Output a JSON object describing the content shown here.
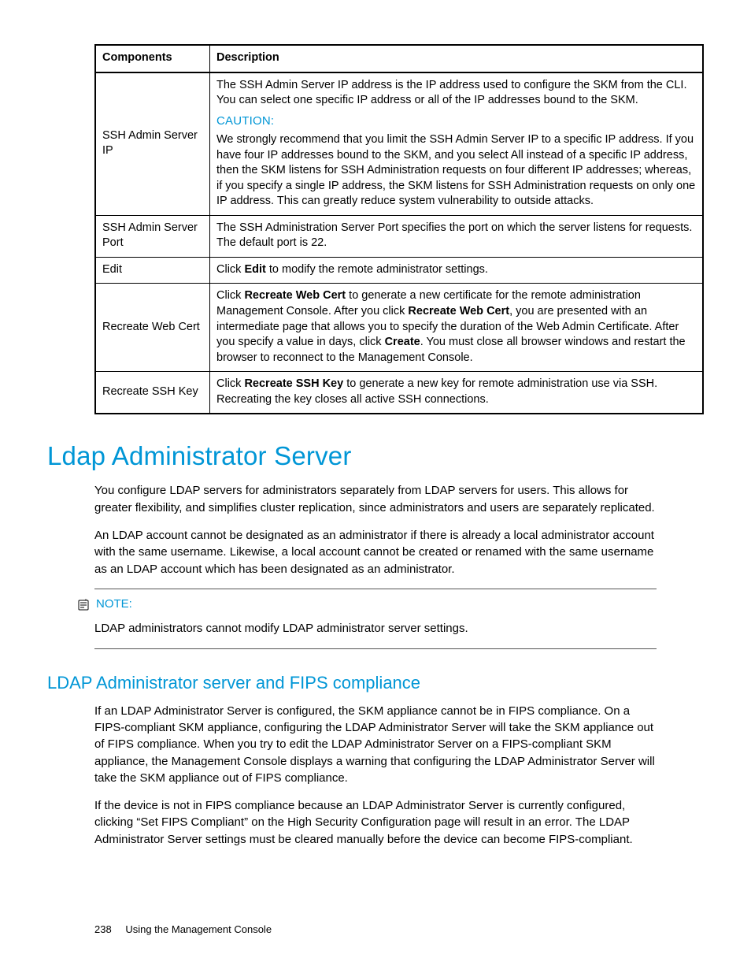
{
  "table": {
    "headers": [
      "Components",
      "Description"
    ],
    "rows": [
      {
        "component": "SSH Admin Server IP",
        "para1": "The SSH Admin Server IP address is the IP address used to configure the SKM from the CLI. You can select one specific IP address or all of the IP addresses bound to the SKM.",
        "caution_label": "CAUTION:",
        "para2": "We strongly recommend that you limit the SSH Admin Server IP to a specific IP address. If you have four IP addresses bound to the SKM, and you select All instead of a specific IP address, then the SKM listens for SSH Administration requests on four different IP addresses; whereas, if you specify a single IP address, the SKM listens for SSH Administration requests on only one IP address. This can greatly reduce system vulnerability to outside attacks."
      },
      {
        "component": "SSH Admin Server Port",
        "para1": "The SSH Administration Server Port specifies the port on which the server listens for requests. The default port is 22."
      },
      {
        "component": "Edit",
        "pre1": "Click ",
        "bold1": "Edit",
        "post1": " to modify the remote administrator settings."
      },
      {
        "component": "Recreate Web Cert",
        "pre1": "Click ",
        "bold1": "Recreate Web Cert",
        "mid1": " to generate a new certificate for the remote administration Management Console. After you click ",
        "bold2": "Recreate Web Cert",
        "mid2": ", you are presented with an intermediate page that allows you to specify the duration of the Web Admin Certificate. After you specify a value in days, click ",
        "bold3": "Create",
        "post1": ". You must close all browser windows and restart the browser to reconnect to the Management Console."
      },
      {
        "component": "Recreate SSH Key",
        "pre1": "Click ",
        "bold1": "Recreate SSH Key",
        "post1": " to generate a new key for remote administration use via SSH. Recreating the key closes all active SSH connections."
      }
    ]
  },
  "section": {
    "title": "Ldap Administrator Server",
    "p1": "You configure LDAP servers for administrators separately from LDAP servers for users. This allows for greater flexibility, and simplifies cluster replication, since administrators and users are separately replicated.",
    "p2": "An LDAP account cannot be designated as an administrator if there is already a local administrator account with the same username. Likewise, a local account cannot be created or renamed with the same username as an LDAP account which has been designated as an administrator."
  },
  "note": {
    "label": "NOTE:",
    "text": "LDAP administrators cannot modify LDAP administrator server settings."
  },
  "subsection": {
    "title": "LDAP Administrator server and FIPS compliance",
    "p1": "If an LDAP Administrator Server is configured, the SKM appliance cannot be in FIPS compliance. On a FIPS-compliant SKM appliance, configuring the LDAP Administrator Server will take the SKM appliance out of FIPS compliance. When you try to edit the LDAP Administrator Server on a FIPS-compliant SKM appliance, the Management Console displays a warning that configuring the LDAP Administrator Server will take the SKM appliance out of FIPS compliance.",
    "p2": "If the device is not in FIPS compliance because an LDAP Administrator Server is currently configured, clicking “Set FIPS Compliant” on the High Security Configuration page will result in an error. The LDAP Administrator Server settings must be cleared manually before the device can become FIPS-compliant."
  },
  "footer": {
    "page": "238",
    "title": "Using the Management Console"
  }
}
